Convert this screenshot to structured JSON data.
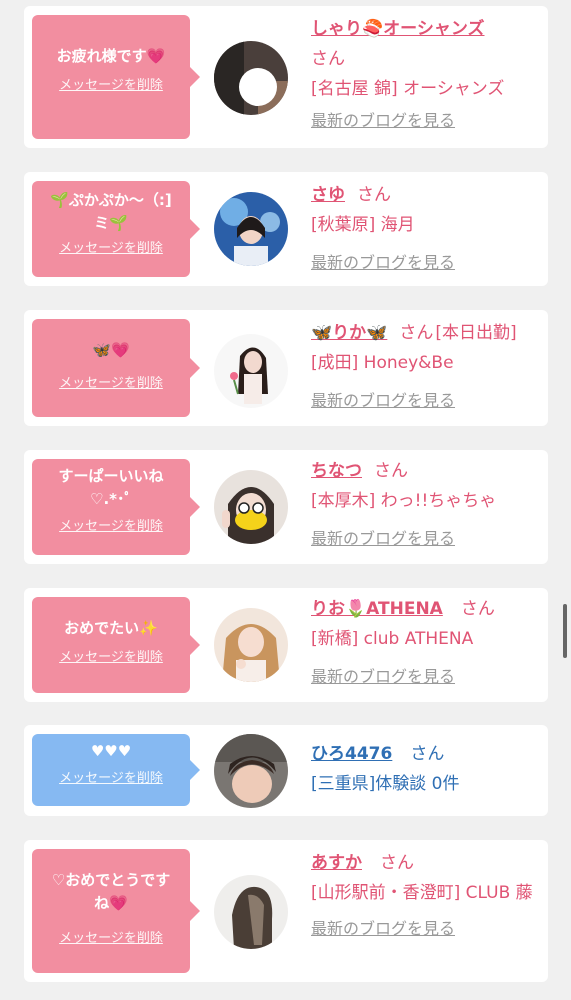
{
  "messages": [
    {
      "bubble_text": "お疲れ様です💗",
      "delete_label": "メッセージを削除",
      "name": "しゃり🍣オーシャンズ",
      "honorific": "さん",
      "shop": "[名古屋 錦] オーシャンズ",
      "blog_label": "最新のブログを見る",
      "bubble_color": "#f28ea0",
      "avatar_icon": "profile-photo"
    },
    {
      "bubble_text": "🌱ぷかぷか〜（:]ミ🌱",
      "delete_label": "メッセージを削除",
      "name": "さゆ",
      "honorific": "さん",
      "shop": "[秋葉原] 海月",
      "blog_label": "最新のブログを見る",
      "bubble_color": "#f28ea0",
      "avatar_icon": "profile-photo"
    },
    {
      "bubble_text": "🦋💗",
      "delete_label": "メッセージを削除",
      "name": "🦋りか🦋",
      "honorific": "さん",
      "status": "[本日出勤]",
      "shop": "[成田] Honey&Be",
      "blog_label": "最新のブログを見る",
      "bubble_color": "#f28ea0",
      "avatar_icon": "profile-photo"
    },
    {
      "bubble_text": "すーぱーいいね♡.*･ﾟ",
      "delete_label": "メッセージを削除",
      "name": "ちなつ",
      "honorific": "さん",
      "shop": "[本厚木] わっ!!ちゃちゃ",
      "blog_label": "最新のブログを見る",
      "bubble_color": "#f28ea0",
      "avatar_icon": "profile-photo"
    },
    {
      "bubble_text": "おめでたい✨",
      "delete_label": "メッセージを削除",
      "name": "りお🌷ATHENA",
      "honorific": "さん",
      "shop": "[新橋] club ATHENA",
      "blog_label": "最新のブログを見る",
      "bubble_color": "#f28ea0",
      "avatar_icon": "profile-photo"
    },
    {
      "bubble_text": "♥♥♥",
      "delete_label": "メッセージを削除",
      "name": "ひろ4476",
      "honorific": "さん",
      "shop": "[三重県]体験談 0件",
      "blog_label": "",
      "bubble_color": "#86b9f2",
      "avatar_icon": "profile-photo"
    },
    {
      "bubble_text": "♡おめでとうですね💗",
      "delete_label": "メッセージを削除",
      "name": "あすか",
      "honorific": "さん",
      "shop": "[山形駅前・香澄町] CLUB 藤",
      "blog_label": "最新のブログを見る",
      "bubble_color": "#f28ea0",
      "avatar_icon": "profile-photo"
    }
  ]
}
